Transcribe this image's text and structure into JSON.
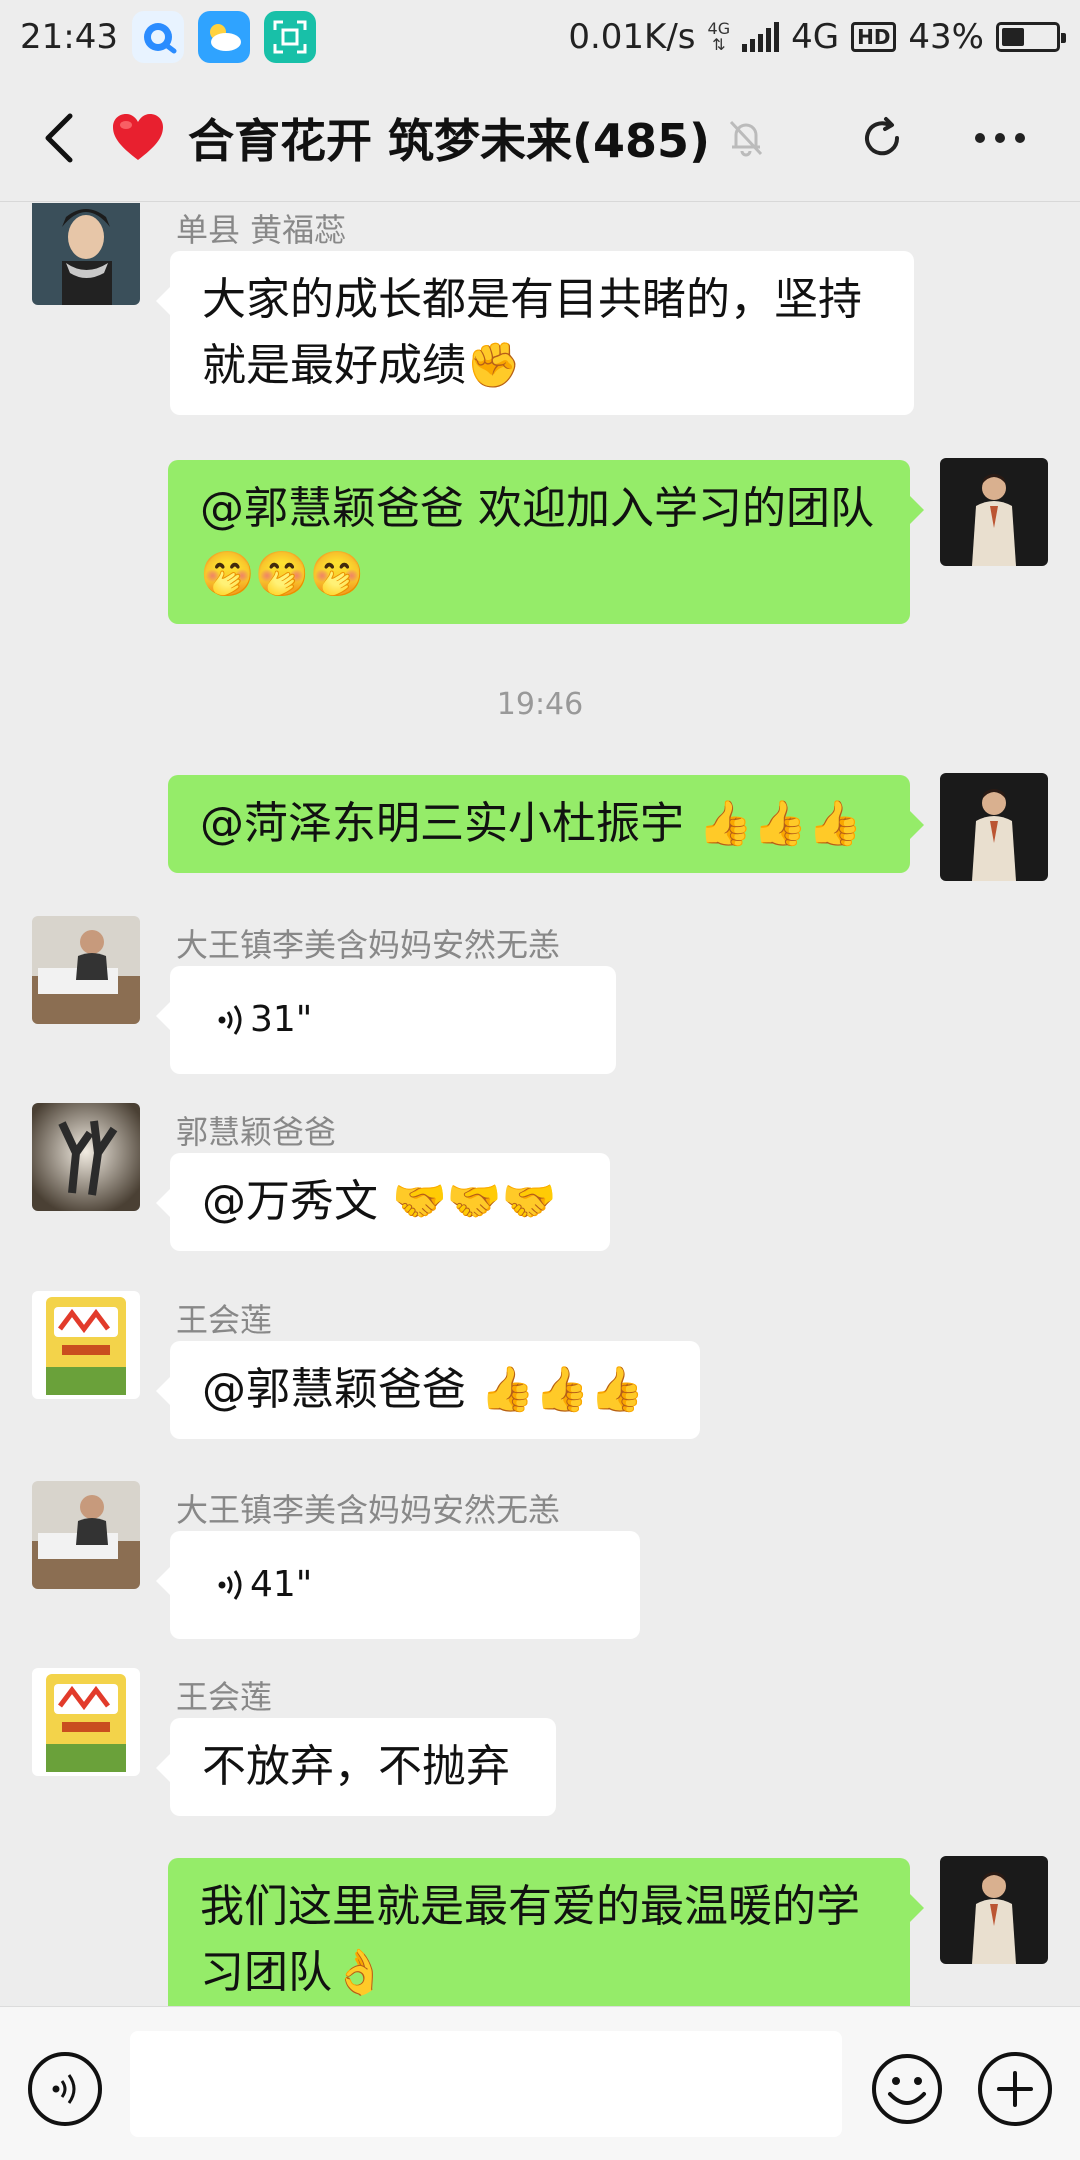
{
  "status_bar": {
    "time": "21:43",
    "net_speed": "0.01K/s",
    "network_small": "4G",
    "network": "4G",
    "hd": "HD",
    "battery_percent": "43%",
    "battery_level": 0.43
  },
  "header": {
    "title": "合育花开 筑梦未来(485)"
  },
  "messages": [
    {
      "sender": "单县  黄福蕊",
      "text": "大家的成长都是有目共睹的，坚持就是最好成绩"
    },
    {
      "text": "@郭慧颖爸爸  欢迎加入学习的团队"
    },
    {
      "time": "19:46"
    },
    {
      "text": "@菏泽东明三实小杜振宇 "
    },
    {
      "sender": "大王镇李美含妈妈安然无恙",
      "voice": "31\""
    },
    {
      "sender": "郭慧颖爸爸",
      "text": "@万秀文 "
    },
    {
      "sender": "王会莲",
      "text": "@郭慧颖爸爸 "
    },
    {
      "sender": "大王镇李美含妈妈安然无恙",
      "voice": "41\""
    },
    {
      "sender": "王会莲",
      "text": "不放弃，不抛弃"
    },
    {
      "text": " 我们这里就是最有爱的最温暖的学习团队"
    }
  ],
  "icons": {
    "back": "back-arrow-icon",
    "heart": "heart-icon",
    "mute": "bell-off-icon",
    "refresh": "refresh-icon",
    "more": "more-dots-icon",
    "voice": "voice-icon",
    "emoji": "emoji-icon",
    "plus": "plus-icon"
  },
  "colors": {
    "outgoing_bubble": "#95ec69",
    "incoming_bubble": "#ffffff",
    "background": "#ededed",
    "heart": "#e8202f"
  }
}
